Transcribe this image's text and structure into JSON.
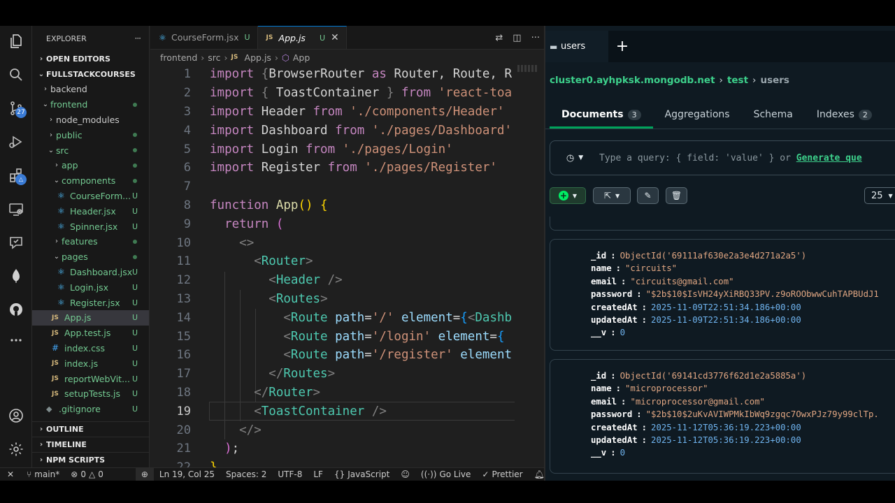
{
  "vscode": {
    "activity": [
      {
        "name": "files-icon"
      },
      {
        "name": "search-icon"
      },
      {
        "name": "source-control-icon",
        "badge": "27"
      },
      {
        "name": "run-debug-icon"
      },
      {
        "name": "extensions-icon"
      },
      {
        "name": "remote-explorer-icon"
      },
      {
        "name": "live-share-icon"
      },
      {
        "name": "mongodb-icon"
      },
      {
        "name": "github-icon"
      },
      {
        "name": "more-icon"
      },
      {
        "name": "account-icon"
      },
      {
        "name": "settings-gear-icon"
      }
    ],
    "explorer": {
      "title": "EXPLORER",
      "more": "···",
      "open_editors": "OPEN EDITORS",
      "workspace": "FULLSTACKCOURSES",
      "tree": [
        {
          "label": "backend",
          "kind": "folder",
          "open": false,
          "depth": 1
        },
        {
          "label": "frontend",
          "kind": "folder",
          "open": true,
          "depth": 1,
          "dot": true
        },
        {
          "label": "node_modules",
          "kind": "folder",
          "open": false,
          "depth": 2
        },
        {
          "label": "public",
          "kind": "folder",
          "open": false,
          "depth": 2,
          "dot": true
        },
        {
          "label": "src",
          "kind": "folder",
          "open": true,
          "depth": 2,
          "dot": true
        },
        {
          "label": "app",
          "kind": "folder",
          "open": false,
          "depth": 3,
          "dot": true
        },
        {
          "label": "components",
          "kind": "folder",
          "open": true,
          "depth": 3,
          "dot": true
        },
        {
          "label": "CourseForm...",
          "kind": "react",
          "depth": 4,
          "mark": "U"
        },
        {
          "label": "Header.jsx",
          "kind": "react",
          "depth": 4,
          "mark": "U"
        },
        {
          "label": "Spinner.jsx",
          "kind": "react",
          "depth": 4,
          "mark": "U"
        },
        {
          "label": "features",
          "kind": "folder",
          "open": false,
          "depth": 3,
          "dot": true
        },
        {
          "label": "pages",
          "kind": "folder",
          "open": true,
          "depth": 3,
          "dot": true
        },
        {
          "label": "Dashboard.jsx",
          "kind": "react",
          "depth": 4,
          "mark": "U"
        },
        {
          "label": "Login.jsx",
          "kind": "react",
          "depth": 4,
          "mark": "U"
        },
        {
          "label": "Register.jsx",
          "kind": "react",
          "depth": 4,
          "mark": "U"
        },
        {
          "label": "App.js",
          "kind": "js",
          "depth": 3,
          "mark": "U",
          "selected": true
        },
        {
          "label": "App.test.js",
          "kind": "js",
          "depth": 3,
          "mark": "U"
        },
        {
          "label": "index.css",
          "kind": "css",
          "depth": 3,
          "mark": "U"
        },
        {
          "label": "index.js",
          "kind": "js",
          "depth": 3,
          "mark": "U"
        },
        {
          "label": "reportWebVit...",
          "kind": "js",
          "depth": 3,
          "mark": "U"
        },
        {
          "label": "setupTests.js",
          "kind": "js",
          "depth": 3,
          "mark": "U"
        },
        {
          "label": ".gitignore",
          "kind": "git",
          "depth": 2,
          "mark": "U"
        }
      ],
      "bottom_sections": [
        "OUTLINE",
        "TIMELINE",
        "NPM SCRIPTS"
      ]
    },
    "tabs": [
      {
        "label": "CourseForm.jsx",
        "mark": "U",
        "active": false,
        "icon": "react"
      },
      {
        "label": "App.js",
        "mark": "U",
        "active": true,
        "icon": "js",
        "close": "✕"
      }
    ],
    "breadcrumb": [
      "frontend",
      "src",
      "App.js",
      "App"
    ],
    "cursor_line": 19,
    "code_lines": [
      [
        [
          "kw",
          "import "
        ],
        [
          "pn",
          "{"
        ],
        [
          "txt",
          "BrowserRouter "
        ],
        [
          "kw",
          "as "
        ],
        [
          "txt",
          "Router, Route, R"
        ]
      ],
      [
        [
          "kw",
          "import "
        ],
        [
          "pn",
          "{ "
        ],
        [
          "txt",
          "ToastContainer "
        ],
        [
          "pn",
          "} "
        ],
        [
          "kw",
          "from "
        ],
        [
          "str",
          "'react-toa"
        ]
      ],
      [
        [
          "kw",
          "import "
        ],
        [
          "txt",
          "Header "
        ],
        [
          "kw",
          "from "
        ],
        [
          "str",
          "'./components/Header'"
        ]
      ],
      [
        [
          "kw",
          "import "
        ],
        [
          "txt",
          "Dashboard "
        ],
        [
          "kw",
          "from "
        ],
        [
          "str",
          "'./pages/Dashboard'"
        ]
      ],
      [
        [
          "kw",
          "import "
        ],
        [
          "txt",
          "Login "
        ],
        [
          "kw",
          "from "
        ],
        [
          "str",
          "'./pages/Login'"
        ]
      ],
      [
        [
          "kw",
          "import "
        ],
        [
          "txt",
          "Register "
        ],
        [
          "kw",
          "from "
        ],
        [
          "str",
          "'./pages/Register'"
        ]
      ],
      [],
      [
        [
          "kw",
          "function "
        ],
        [
          "fn",
          "App"
        ],
        [
          "br1",
          "() {"
        ]
      ],
      [
        [
          "txt",
          "  "
        ],
        [
          "kw",
          "return "
        ],
        [
          "br2",
          "("
        ]
      ],
      [
        [
          "txt",
          "    "
        ],
        [
          "pn",
          "<>"
        ]
      ],
      [
        [
          "txt",
          "      "
        ],
        [
          "pn",
          "<"
        ],
        [
          "tag",
          "Router"
        ],
        [
          "pn",
          ">"
        ]
      ],
      [
        [
          "txt",
          "        "
        ],
        [
          "pn",
          "<"
        ],
        [
          "tag",
          "Header "
        ],
        [
          "pn",
          "/>"
        ]
      ],
      [
        [
          "txt",
          "        "
        ],
        [
          "pn",
          "<"
        ],
        [
          "tag",
          "Routes"
        ],
        [
          "pn",
          ">"
        ]
      ],
      [
        [
          "txt",
          "          "
        ],
        [
          "pn",
          "<"
        ],
        [
          "tag",
          "Route "
        ],
        [
          "attr",
          "path"
        ],
        [
          "txt",
          "="
        ],
        [
          "str",
          "'/' "
        ],
        [
          "attr",
          "element"
        ],
        [
          "txt",
          "="
        ],
        [
          "br3",
          "{"
        ],
        [
          "pn",
          "<"
        ],
        [
          "tag",
          "Dashb"
        ]
      ],
      [
        [
          "txt",
          "          "
        ],
        [
          "pn",
          "<"
        ],
        [
          "tag",
          "Route "
        ],
        [
          "attr",
          "path"
        ],
        [
          "txt",
          "="
        ],
        [
          "str",
          "'/login' "
        ],
        [
          "attr",
          "element"
        ],
        [
          "txt",
          "="
        ],
        [
          "br3",
          "{"
        ]
      ],
      [
        [
          "txt",
          "          "
        ],
        [
          "pn",
          "<"
        ],
        [
          "tag",
          "Route "
        ],
        [
          "attr",
          "path"
        ],
        [
          "txt",
          "="
        ],
        [
          "str",
          "'/register' "
        ],
        [
          "attr",
          "element"
        ]
      ],
      [
        [
          "txt",
          "        "
        ],
        [
          "pn",
          "</"
        ],
        [
          "tag",
          "Routes"
        ],
        [
          "pn",
          ">"
        ]
      ],
      [
        [
          "txt",
          "      "
        ],
        [
          "pn",
          "</"
        ],
        [
          "tag",
          "Router"
        ],
        [
          "pn",
          ">"
        ]
      ],
      [
        [
          "txt",
          "      "
        ],
        [
          "pn",
          "<"
        ],
        [
          "tag",
          "ToastContainer "
        ],
        [
          "pn",
          "/>"
        ]
      ],
      [
        [
          "txt",
          "    "
        ],
        [
          "pn",
          "</>"
        ]
      ],
      [
        [
          "txt",
          "  "
        ],
        [
          "br2",
          ")"
        ],
        [
          "txt",
          ";"
        ]
      ],
      [
        [
          "br1",
          "}"
        ]
      ]
    ],
    "status": {
      "branch": "main*",
      "errors": "0",
      "warnings": "0",
      "position": "Ln 19, Col 25",
      "spaces": "Spaces: 2",
      "encoding": "UTF-8",
      "eol": "LF",
      "language": "JavaScript",
      "golive": "Go Live",
      "prettier": "Prettier"
    }
  },
  "mongo": {
    "tab": {
      "label": "users",
      "add": "+"
    },
    "breadcrumb": {
      "cluster": "cluster0.ayhpksk.mongodb.net",
      "db": "test",
      "coll": "users"
    },
    "nav": [
      {
        "label": "Documents",
        "badge": "3",
        "active": true
      },
      {
        "label": "Aggregations",
        "badge": "",
        "active": false
      },
      {
        "label": "Schema",
        "badge": "",
        "active": false
      },
      {
        "label": "Indexes",
        "badge": "2",
        "active": false
      }
    ],
    "query": {
      "placeholder": "Type a query: { field: 'value' } or ",
      "generate": "Generate que"
    },
    "page_size": "25",
    "documents": [
      {
        "fields": [
          {
            "k": "_id",
            "v": "ObjectId('69111af630e2a3e4d271a2a5')",
            "t": "oid"
          },
          {
            "k": "name",
            "v": "\"circuits\"",
            "t": "str"
          },
          {
            "k": "email",
            "v": "\"circuits@gmail.com\"",
            "t": "str"
          },
          {
            "k": "password",
            "v": "\"$2b$10$IsVH24yXiRBQ33PV.z9oROObwwCuhTAPBUdJ1",
            "t": "str"
          },
          {
            "k": "createdAt",
            "v": "2025-11-09T22:51:34.186+00:00",
            "t": "date"
          },
          {
            "k": "updatedAt",
            "v": "2025-11-09T22:51:34.186+00:00",
            "t": "date"
          },
          {
            "k": "__v",
            "v": "0",
            "t": "num"
          }
        ]
      },
      {
        "fields": [
          {
            "k": "_id",
            "v": "ObjectId('69141cd3776f62d1e2a5885a')",
            "t": "oid"
          },
          {
            "k": "name",
            "v": "\"microprocessor\"",
            "t": "str"
          },
          {
            "k": "email",
            "v": "\"microprocessor@gmail.com\"",
            "t": "str"
          },
          {
            "k": "password",
            "v": "\"$2b$10$2uKvAVIWPMkIbWq9zgqc7OwxPJz79y99clTp.",
            "t": "str"
          },
          {
            "k": "createdAt",
            "v": "2025-11-12T05:36:19.223+00:00",
            "t": "date"
          },
          {
            "k": "updatedAt",
            "v": "2025-11-12T05:36:19.223+00:00",
            "t": "date"
          },
          {
            "k": "__v",
            "v": "0",
            "t": "num"
          }
        ]
      }
    ]
  }
}
